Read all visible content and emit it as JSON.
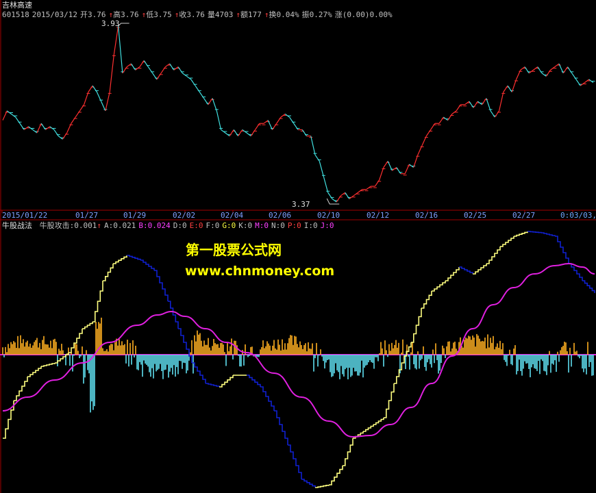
{
  "header": {
    "stock_name": "吉林高速",
    "info": [
      {
        "text": "601518",
        "color": "#c0c0c0"
      },
      {
        "text": "2015/03/12",
        "color": "#c0c0c0"
      },
      {
        "text": "开3.76",
        "color": "#c0c0c0"
      },
      {
        "text": "↑",
        "color": "#ff4040"
      },
      {
        "text": "高3.76",
        "color": "#c0c0c0"
      },
      {
        "text": "↑",
        "color": "#ff4040"
      },
      {
        "text": "低3.75",
        "color": "#c0c0c0"
      },
      {
        "text": "↑",
        "color": "#ff4040"
      },
      {
        "text": "收3.76",
        "color": "#c0c0c0"
      },
      {
        "text": "量4703",
        "color": "#c0c0c0"
      },
      {
        "text": "↑",
        "color": "#ff4040"
      },
      {
        "text": "额177",
        "color": "#c0c0c0"
      },
      {
        "text": "↑",
        "color": "#ff4040"
      },
      {
        "text": "换0.04%",
        "color": "#c0c0c0"
      },
      {
        "text": "振0.27%",
        "color": "#c0c0c0"
      },
      {
        "text": "涨(0.00)0.00%",
        "color": "#c0c0c0"
      }
    ]
  },
  "price_panel": {
    "high_label": "3.93",
    "low_label": "3.37"
  },
  "date_axis": [
    "2015/01/22",
    "01/27",
    "01/29",
    "02/02",
    "02/04",
    "02/06",
    "02/10",
    "02/12",
    "02/16",
    "02/25",
    "02/27",
    "0:03/03,1"
  ],
  "indicator": {
    "title": "牛股战法",
    "params": [
      {
        "text": "牛股攻击:0.001",
        "color": "#c0c0c0"
      },
      {
        "text": "↑",
        "color": "#ff4040"
      },
      {
        "text": "A:0.021",
        "color": "#c0c0c0"
      },
      {
        "text": "B:0.024",
        "color": "#ff40ff"
      },
      {
        "text": "D:0",
        "color": "#c0c0c0"
      },
      {
        "text": "E:0",
        "color": "#ff4040"
      },
      {
        "text": "F:0",
        "color": "#c0c0c0"
      },
      {
        "text": "G:0",
        "color": "#ffff40"
      },
      {
        "text": "K:0",
        "color": "#c0c0c0"
      },
      {
        "text": "M:0",
        "color": "#ff40ff"
      },
      {
        "text": "N:0",
        "color": "#c0c0c0"
      },
      {
        "text": "P:0",
        "color": "#ff4040"
      },
      {
        "text": "I:0",
        "color": "#c0c0c0"
      },
      {
        "text": "J:0",
        "color": "#ff40ff"
      }
    ]
  },
  "watermark": {
    "line1": "第一股票公式网",
    "line2": "www.chnmoney.com"
  },
  "colors": {
    "up": "#ff3030",
    "down": "#40e0e0",
    "osc_line": "#ffff80",
    "osc_line_down": "#1020d0",
    "ma_line": "#e020e0",
    "bar_up": "#ffb020",
    "bar_down": "#60e0f0",
    "grid_red": "#a00000"
  },
  "price_series": [
    3.63,
    3.66,
    3.65,
    3.64,
    3.62,
    3.6,
    3.61,
    3.6,
    3.59,
    3.62,
    3.6,
    3.61,
    3.6,
    3.58,
    3.57,
    3.59,
    3.62,
    3.64,
    3.66,
    3.68,
    3.72,
    3.74,
    3.72,
    3.69,
    3.66,
    3.72,
    3.84,
    3.93,
    3.78,
    3.8,
    3.81,
    3.79,
    3.8,
    3.82,
    3.8,
    3.78,
    3.76,
    3.78,
    3.8,
    3.81,
    3.79,
    3.8,
    3.78,
    3.77,
    3.76,
    3.74,
    3.72,
    3.7,
    3.68,
    3.7,
    3.66,
    3.6,
    3.59,
    3.58,
    3.6,
    3.58,
    3.6,
    3.59,
    3.58,
    3.6,
    3.62,
    3.62,
    3.63,
    3.6,
    3.62,
    3.64,
    3.65,
    3.64,
    3.62,
    3.6,
    3.6,
    3.58,
    3.58,
    3.52,
    3.5,
    3.45,
    3.4,
    3.38,
    3.37,
    3.39,
    3.4,
    3.38,
    3.39,
    3.4,
    3.41,
    3.41,
    3.42,
    3.42,
    3.44,
    3.48,
    3.5,
    3.47,
    3.48,
    3.46,
    3.46,
    3.49,
    3.48,
    3.52,
    3.55,
    3.58,
    3.6,
    3.62,
    3.62,
    3.64,
    3.63,
    3.65,
    3.66,
    3.68,
    3.68,
    3.69,
    3.67,
    3.69,
    3.68,
    3.7,
    3.66,
    3.64,
    3.66,
    3.72,
    3.74,
    3.72,
    3.76,
    3.79,
    3.8,
    3.78,
    3.79,
    3.8,
    3.78,
    3.77,
    3.79,
    3.8,
    3.81,
    3.78,
    3.8,
    3.78,
    3.76,
    3.74,
    3.75,
    3.76,
    3.75
  ]
}
